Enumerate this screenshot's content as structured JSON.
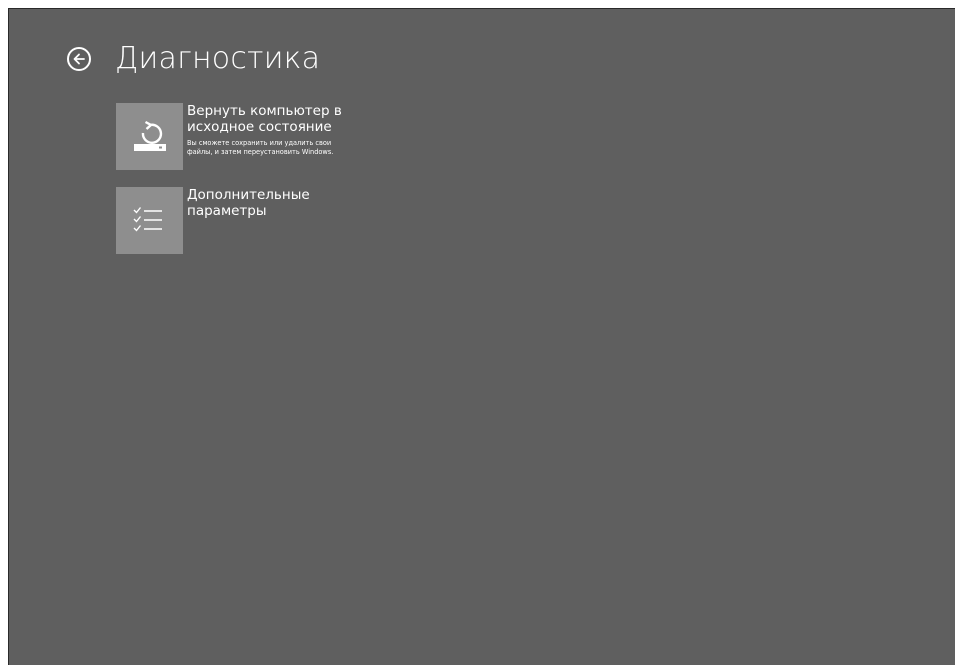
{
  "header": {
    "title": "Диагностика",
    "back_icon": "back-arrow-circle-icon"
  },
  "options": [
    {
      "title": "Вернуть компьютер в исходное состояние",
      "description": "Вы сможете сохранить или удалить свои файлы, и затем переустановить Windows.",
      "icon": "reset-pc-icon"
    },
    {
      "title": "Дополнительные параметры",
      "icon": "checklist-icon"
    }
  ],
  "colors": {
    "background": "#5f5f5f",
    "tile": "#8e8e8e",
    "text": "#ffffff"
  }
}
